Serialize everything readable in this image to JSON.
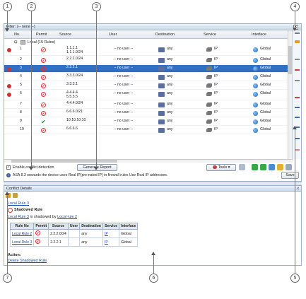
{
  "callouts": [
    "1",
    "2",
    "3",
    "4",
    "5",
    "6",
    "7"
  ],
  "filter_bar": {
    "text": "Filter: (-- none --)",
    "close": "x"
  },
  "columns": [
    "No.",
    "Permit",
    "Source",
    "User",
    "Destination",
    "Service",
    "Interface"
  ],
  "group": {
    "label": "Local (15 Rules)",
    "toggle": "⊟"
  },
  "rows": [
    {
      "no": "1",
      "permit": "deny",
      "source": "1.1.1.1\n1.1.1.0/24",
      "user": "-- no user --",
      "destination": "any",
      "service": "IP",
      "interface": "Global",
      "flag": true
    },
    {
      "no": "2",
      "permit": "deny",
      "source": "2.2.2.0/24",
      "user": "-- no user --",
      "destination": "any",
      "service": "IP",
      "interface": "Global",
      "flag": false
    },
    {
      "no": "3",
      "permit": "deny",
      "source": "2.2.2.1",
      "user": "-- no user --",
      "destination": "any",
      "service": "IP",
      "interface": "Global",
      "flag": true
    },
    {
      "no": "4",
      "permit": "deny",
      "source": "3.3.3.0/24",
      "user": "-- no user --",
      "destination": "any",
      "service": "IP",
      "interface": "Global",
      "flag": false
    },
    {
      "no": "5",
      "permit": "deny",
      "source": "3.3.3.1",
      "user": "-- no user --",
      "destination": "any",
      "service": "IP",
      "interface": "Global",
      "flag": true
    },
    {
      "no": "6",
      "permit": "deny",
      "source": "4.4.4.4\n5.5.5.5",
      "user": "-- no user --",
      "destination": "any",
      "service": "IP",
      "interface": "Global",
      "flag": true
    },
    {
      "no": "7",
      "permit": "deny",
      "source": "4.4.4.0/24",
      "user": "-- no user --",
      "destination": "any",
      "service": "IP",
      "interface": "Global",
      "flag": false
    },
    {
      "no": "8",
      "permit": "deny",
      "source": "6.6.6.0/21",
      "user": "-- no user --",
      "destination": "any",
      "service": "IP",
      "interface": "Global",
      "flag": false
    },
    {
      "no": "9",
      "permit": "permit",
      "source": "10.10.10.10",
      "user": "-- no user --",
      "destination": "any",
      "service": "IP",
      "interface": "Global",
      "flag": false
    },
    {
      "no": "10",
      "permit": "deny",
      "source": "6.6.6.6",
      "user": "-- no user --",
      "destination": "any",
      "service": "IP",
      "interface": "Global",
      "flag": false
    }
  ],
  "selected_row_no": "3",
  "enable_conflict_detection": {
    "label": "Enable conflict detection",
    "checked": "✓"
  },
  "generate_report_label": "Generate Report",
  "tools_label": "Tools ▾",
  "info_icon": "i",
  "info_text": "ASA 8.3 onwards the device uses Real IP(pre-nated IP) in firewall rules Use Real IP addresses.",
  "save_label": "Save",
  "conflict_details": {
    "title": "Conflict Details",
    "controls": "↕ x",
    "rule_link": "Local Rule 3",
    "heading": "Shadowed Rule",
    "shadowed_by_prefix": "Local Rule 3",
    "shadowed_by_mid": " is shadowed by ",
    "shadowed_by_target": "Local rule 2",
    "table_headers": [
      "Rule No",
      "Permit",
      "Source",
      "User",
      "Destination",
      "Service",
      "Interface"
    ],
    "table_rows": [
      {
        "rule": "Local Rule 2",
        "source": "2.2.2.0/24",
        "user": "",
        "destination": "any",
        "service": "IP",
        "interface": "Global"
      },
      {
        "rule": "Local Rule 3",
        "source": "2.2.2.1",
        "user": "",
        "destination": "any",
        "service": "IP",
        "interface": "Global"
      }
    ],
    "action_label": "Action:",
    "action_link": "Delete Shadowed Rule"
  },
  "colors": {
    "selected_row": "#2f6fc6",
    "deny": "#d33",
    "permit": "#1a9a1a",
    "link": "#1a4fb0"
  }
}
